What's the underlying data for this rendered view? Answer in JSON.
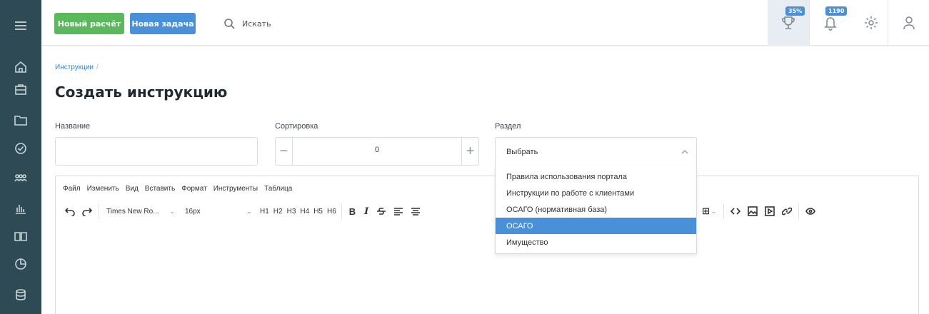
{
  "header": {
    "new_calc_label": "Новый расчёт",
    "new_task_label": "Новая задача",
    "search_placeholder": "Искать",
    "trophy_badge": "35%",
    "bell_badge": "1190"
  },
  "breadcrumb": {
    "parent": "Инструкции",
    "separator": "/"
  },
  "page": {
    "title": "Создать инструкцию"
  },
  "form": {
    "name_label": "Название",
    "name_value": "",
    "sort_label": "Сортировка",
    "sort_value": "0",
    "section_label": "Раздел",
    "section_value": "Выбрать",
    "section_options": [
      "Правила использования портала",
      "Инструкции по работе с клиентами",
      "ОСАГО (нормативная база)",
      "ОСАГО",
      "Имущество"
    ],
    "section_highlighted": "ОСАГО"
  },
  "editor": {
    "menu": [
      "Файл",
      "Изменить",
      "Вид",
      "Вставить",
      "Формат",
      "Инструменты",
      "Таблица"
    ],
    "font_family": "Times New Ro...",
    "font_size": "16px",
    "headings": [
      "H1",
      "H2",
      "H3",
      "H4",
      "H5",
      "H6"
    ],
    "bold": "B",
    "italic": "I"
  },
  "colors": {
    "sidebar": "#2d4a55",
    "primary": "#4a90d9",
    "success": "#5cb85c"
  }
}
